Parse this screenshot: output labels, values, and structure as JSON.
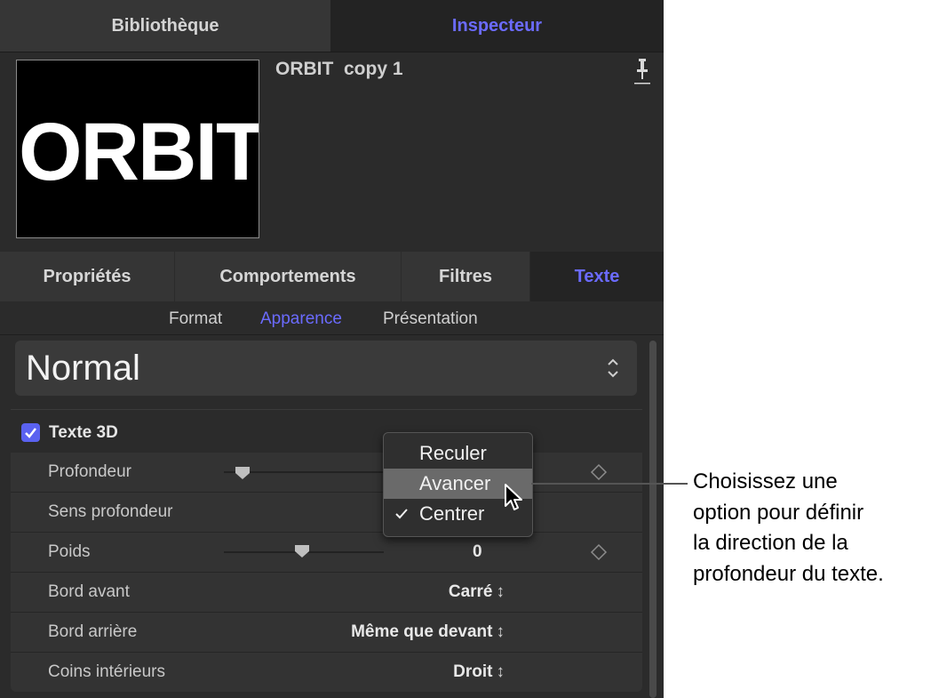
{
  "top_tabs": {
    "library": "Bibliothèque",
    "inspector": "Inspecteur"
  },
  "preview": {
    "thumbnail_text": "ORBIT",
    "object_name": "ORBIT  copy 1"
  },
  "inspector_tabs": [
    "Propriétés",
    "Comportements",
    "Filtres",
    "Texte"
  ],
  "sub_tabs": [
    "Format",
    "Apparence",
    "Présentation"
  ],
  "style_popup": {
    "value": "Normal"
  },
  "section": {
    "label": "Texte 3D",
    "checked": true
  },
  "rows": {
    "depth": {
      "label": "Profondeur"
    },
    "depth_direction": {
      "label": "Sens profondeur"
    },
    "weight": {
      "label": "Poids",
      "value": "0"
    },
    "front_edge": {
      "label": "Bord avant",
      "value": "Carré"
    },
    "back_edge": {
      "label": "Bord arrière",
      "value": "Même que devant"
    },
    "inner_corners": {
      "label": "Coins intérieurs",
      "value": "Droit"
    }
  },
  "dropdown": {
    "options": [
      "Reculer",
      "Avancer",
      "Centrer"
    ],
    "highlighted": "Avancer",
    "checked": "Centrer"
  },
  "callout": {
    "text": "Choisissez une\noption pour définir\nla direction de la\nprofondeur du texte."
  },
  "colors": {
    "accent": "#6b6bff",
    "panel_bg": "#2b2b2b",
    "checkbox": "#5a62f0"
  }
}
